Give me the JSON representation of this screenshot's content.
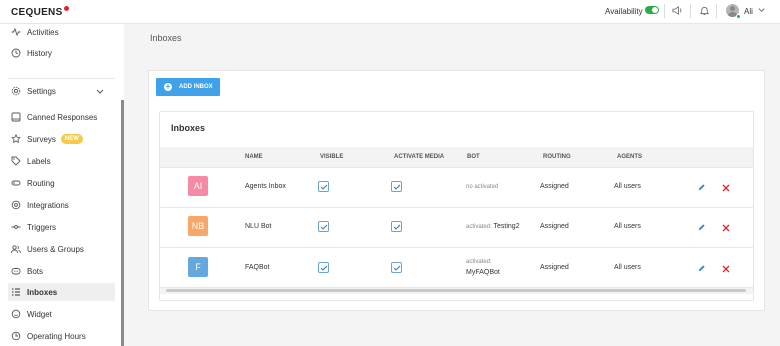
{
  "brand": {
    "name": "CEQUENS",
    "accent": "#e0262a"
  },
  "header": {
    "availability_label": "Availability",
    "availability_on": true,
    "user_name": "Ali",
    "icons": [
      "speaker-icon",
      "bell-icon",
      "user-avatar",
      "chevron-down-icon"
    ]
  },
  "sidebar": {
    "top_items": [
      {
        "label": "Activities",
        "icon": "activity-icon"
      },
      {
        "label": "History",
        "icon": "clock-icon"
      }
    ],
    "settings": {
      "label": "Settings",
      "icon": "gear-icon"
    },
    "items": [
      {
        "label": "Canned Responses",
        "icon": "canned-icon"
      },
      {
        "label": "Surveys",
        "icon": "star-icon",
        "badge": "NEW"
      },
      {
        "label": "Labels",
        "icon": "tag-icon"
      },
      {
        "label": "Routing",
        "icon": "routing-icon"
      },
      {
        "label": "Integrations",
        "icon": "integrations-icon"
      },
      {
        "label": "Triggers",
        "icon": "trigger-icon"
      },
      {
        "label": "Users & Groups",
        "icon": "users-icon"
      },
      {
        "label": "Bots",
        "icon": "bot-icon"
      },
      {
        "label": "Inboxes",
        "icon": "inbox-list-icon",
        "active": true
      },
      {
        "label": "Widget",
        "icon": "widget-icon"
      },
      {
        "label": "Operating Hours",
        "icon": "hours-icon"
      }
    ]
  },
  "main": {
    "page_title": "Inboxes",
    "add_button": "ADD INBOX",
    "card_title": "Inboxes",
    "columns": [
      "NAME",
      "VISIBLE",
      "ACTIVATE MEDIA",
      "BOT",
      "ROUTING",
      "AGENTS"
    ],
    "rows": [
      {
        "initials": "AI",
        "color": "#f589a6",
        "name": "Agents Inbox",
        "visible": true,
        "activate_media": true,
        "bot_status": "no activated",
        "bot_name": "",
        "routing": "Assigned",
        "agents": "All users"
      },
      {
        "initials": "NB",
        "color": "#f7a76a",
        "name": "NLU Bot",
        "visible": true,
        "activate_media": true,
        "bot_status": "activated:",
        "bot_name": "Testing2",
        "routing": "Assigned",
        "agents": "All users"
      },
      {
        "initials": "F",
        "color": "#63a9e0",
        "name": "FAQBot",
        "visible": true,
        "activate_media": true,
        "bot_status": "activated:",
        "bot_name": "MyFAQBot",
        "routing": "Assigned",
        "agents": "All users"
      }
    ],
    "colors": {
      "primary": "#3fa1ea",
      "delete": "#e0262a",
      "edit": "#2e86d6"
    }
  }
}
